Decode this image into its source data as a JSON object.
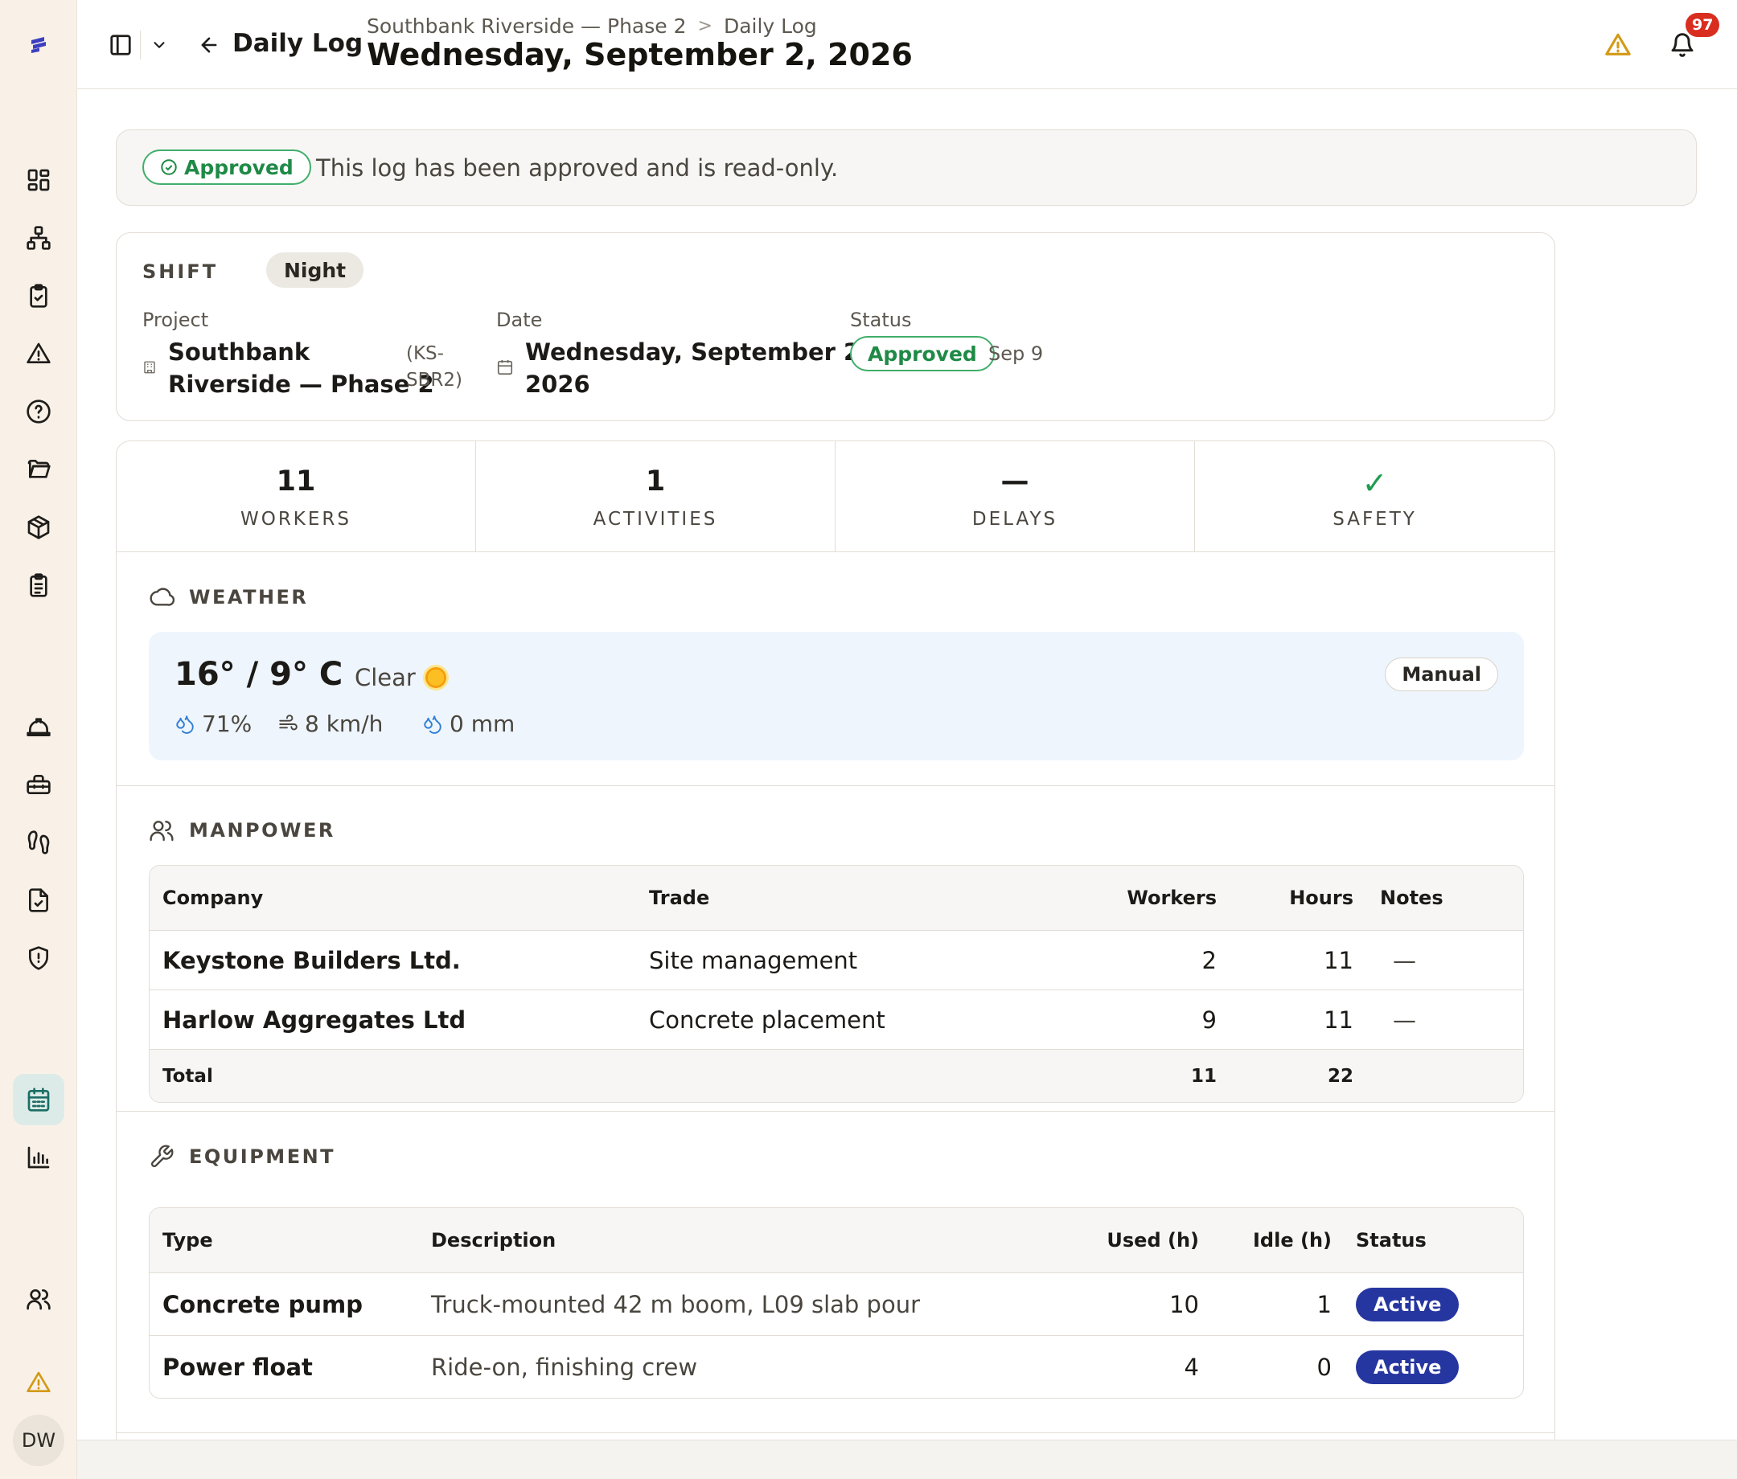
{
  "sidebar": {
    "avatar_initials": "DW",
    "accent": "#1b6e63",
    "items": [
      {
        "icon": "dashboard-icon"
      },
      {
        "icon": "hierarchy-icon"
      },
      {
        "icon": "clipboard-check-icon"
      },
      {
        "icon": "warning-icon"
      },
      {
        "icon": "help-icon"
      },
      {
        "icon": "folder-icon"
      },
      {
        "icon": "package-icon"
      },
      {
        "icon": "clipboard-list-icon"
      },
      {
        "icon": "hard-hat-icon"
      },
      {
        "icon": "toolbox-icon"
      },
      {
        "icon": "footprints-icon"
      },
      {
        "icon": "file-check-icon"
      },
      {
        "icon": "shield-icon"
      },
      {
        "icon": "calendar-icon"
      },
      {
        "icon": "bar-chart-icon"
      },
      {
        "icon": "users-icon"
      },
      {
        "icon": "alert-icon"
      }
    ]
  },
  "header": {
    "back_label": "Daily Log",
    "breadcrumb": [
      "Southbank Riverside — Phase 2",
      "Daily Log"
    ],
    "title": "Wednesday, September 2, 2026",
    "notification_count": "97"
  },
  "banner": {
    "badge": "Approved",
    "message": "This log has been approved and is read-only."
  },
  "shift": {
    "label": "SHIFT",
    "value": "Night",
    "project_label": "Project",
    "project_name_line1": "Southbank",
    "project_name_line2": "Riverside — Phase 2",
    "project_code_line1": "(KS-",
    "project_code_line2": "SBR2)",
    "date_label": "Date",
    "date_line1": "Wednesday, September 2,",
    "date_line2": "2026",
    "status_label": "Status",
    "status_value": "Approved",
    "status_date": "Sep 9"
  },
  "stats": [
    {
      "value": "11",
      "label": "WORKERS"
    },
    {
      "value": "1",
      "label": "ACTIVITIES"
    },
    {
      "value": "—",
      "label": "DELAYS"
    },
    {
      "value": "✓",
      "label": "SAFETY"
    }
  ],
  "weather": {
    "heading": "WEATHER",
    "temp": "16° / 9° C",
    "condition": "Clear",
    "humidity": "71%",
    "wind": "8 km/h",
    "precip": "0 mm",
    "source": "Manual"
  },
  "manpower": {
    "heading": "MANPOWER",
    "columns": [
      "Company",
      "Trade",
      "Workers",
      "Hours",
      "Notes"
    ],
    "rows": [
      {
        "company": "Keystone Builders Ltd.",
        "trade": "Site management",
        "workers": "2",
        "hours": "11",
        "notes": "—"
      },
      {
        "company": "Harlow Aggregates Ltd",
        "trade": "Concrete placement",
        "workers": "9",
        "hours": "11",
        "notes": "—"
      }
    ],
    "total": {
      "label": "Total",
      "workers": "11",
      "hours": "22"
    }
  },
  "equipment": {
    "heading": "EQUIPMENT",
    "columns": [
      "Type",
      "Description",
      "Used (h)",
      "Idle (h)",
      "Status"
    ],
    "rows": [
      {
        "type": "Concrete pump",
        "description": "Truck-mounted 42 m boom, L09 slab pour",
        "used": "10",
        "idle": "1",
        "status": "Active"
      },
      {
        "type": "Power float",
        "description": "Ride-on, finishing crew",
        "used": "4",
        "idle": "0",
        "status": "Active"
      }
    ]
  }
}
